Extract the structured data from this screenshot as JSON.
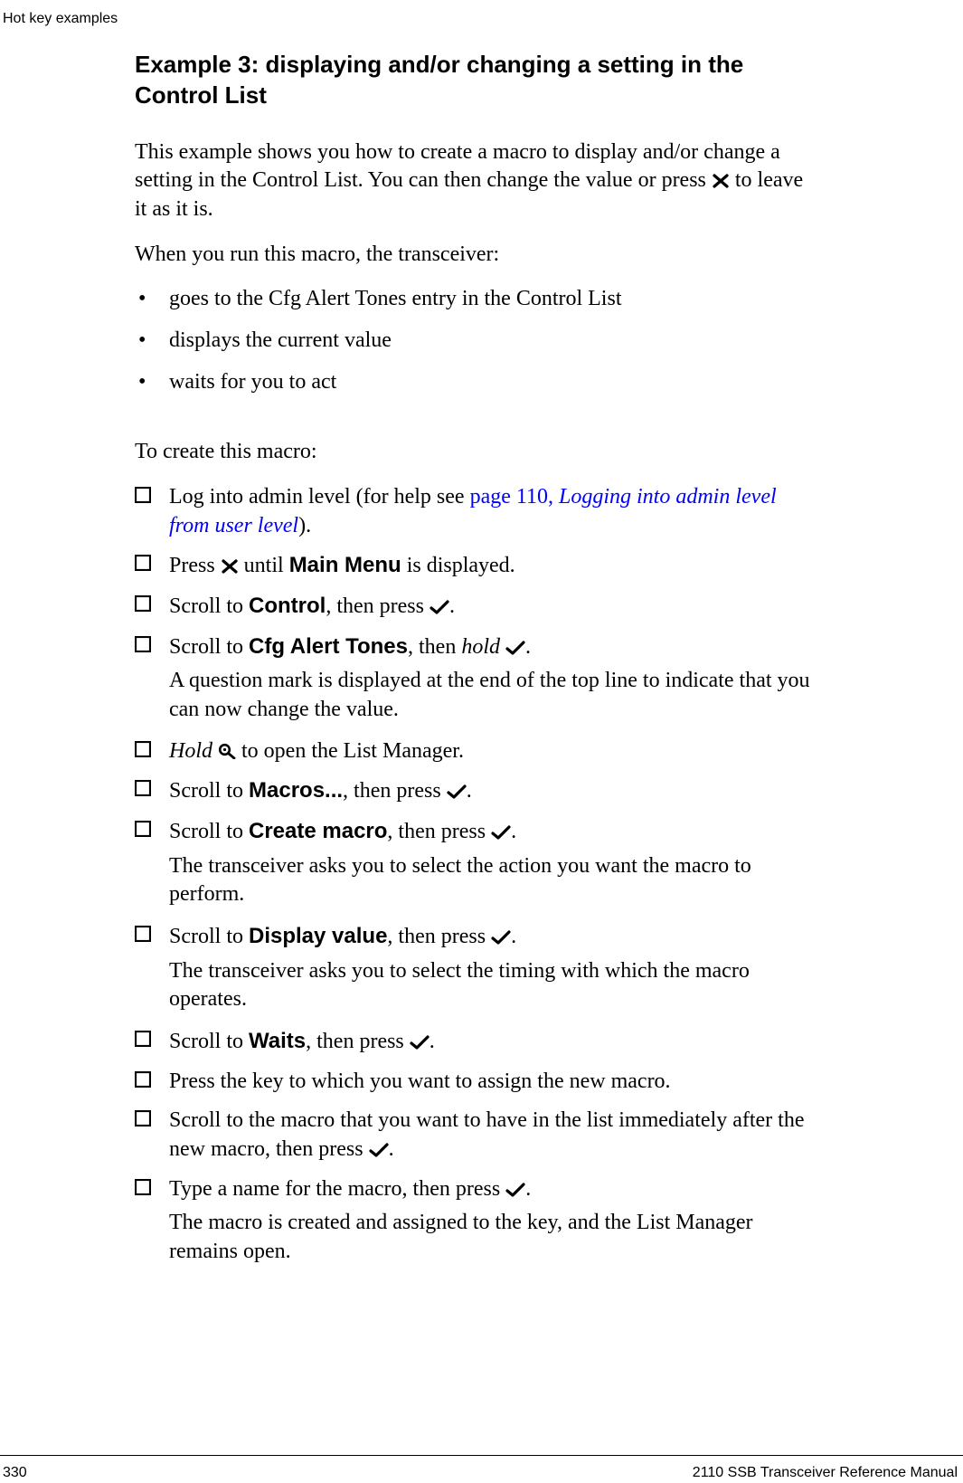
{
  "header": {
    "running": "Hot key examples"
  },
  "title": "Example 3: displaying and/or changing a setting in the Control List",
  "intro1a": "This example shows you how to create a macro to display and/or change a setting in the Control List. You can then change the value or press ",
  "intro1b": " to leave it as it is.",
  "intro2": "When you run this macro, the transceiver:",
  "bullets": [
    "goes to the Cfg Alert Tones entry in the Control List",
    "displays the current value",
    "waits for you to act"
  ],
  "lead2": "To create this macro:",
  "steps": {
    "s1a": "Log into admin level (for help see ",
    "s1_link1": "page 110, ",
    "s1_link2": "Logging into admin level from user level",
    "s1b": ").",
    "s2a": "Press ",
    "s2b": " until ",
    "s2_bold": "Main Menu",
    "s2c": " is displayed.",
    "s3a": "Scroll to ",
    "s3_bold": "Control",
    "s3b": ", then press ",
    "s3c": ".",
    "s4a": "Scroll to ",
    "s4_bold": "Cfg Alert Tones",
    "s4b": ", then ",
    "s4_it": "hold",
    "s4c": " ",
    "s4d": ".",
    "s4_sub": "A question mark is displayed at the end of the top line to indicate that you can now change the value.",
    "s5_it": "Hold",
    "s5a": " ",
    "s5b": " to open the List Manager.",
    "s6a": "Scroll to ",
    "s6_bold": "Macros...",
    "s6b": ", then press ",
    "s6c": ".",
    "s7a": "Scroll to ",
    "s7_bold": "Create macro",
    "s7b": ", then press ",
    "s7c": ".",
    "s7_sub": "The transceiver asks you to select the action you want the macro to perform.",
    "s8a": "Scroll to ",
    "s8_bold": "Display value",
    "s8b": ", then press ",
    "s8c": ".",
    "s8_sub": "The transceiver asks you to select the timing with which the macro operates.",
    "s9a": "Scroll to ",
    "s9_bold": "Waits",
    "s9b": ", then press ",
    "s9c": ".",
    "s10": "Press the key to which you want to assign the new macro.",
    "s11a": "Scroll to the macro that you want to have in the list immediately after the new macro, then press ",
    "s11b": ".",
    "s12a": "Type a name for the macro, then press ",
    "s12b": ".",
    "s12_sub": "The macro is created and assigned to the key, and the List Manager remains open."
  },
  "footer": {
    "page": "330",
    "doc": "2110 SSB Transceiver Reference Manual"
  }
}
